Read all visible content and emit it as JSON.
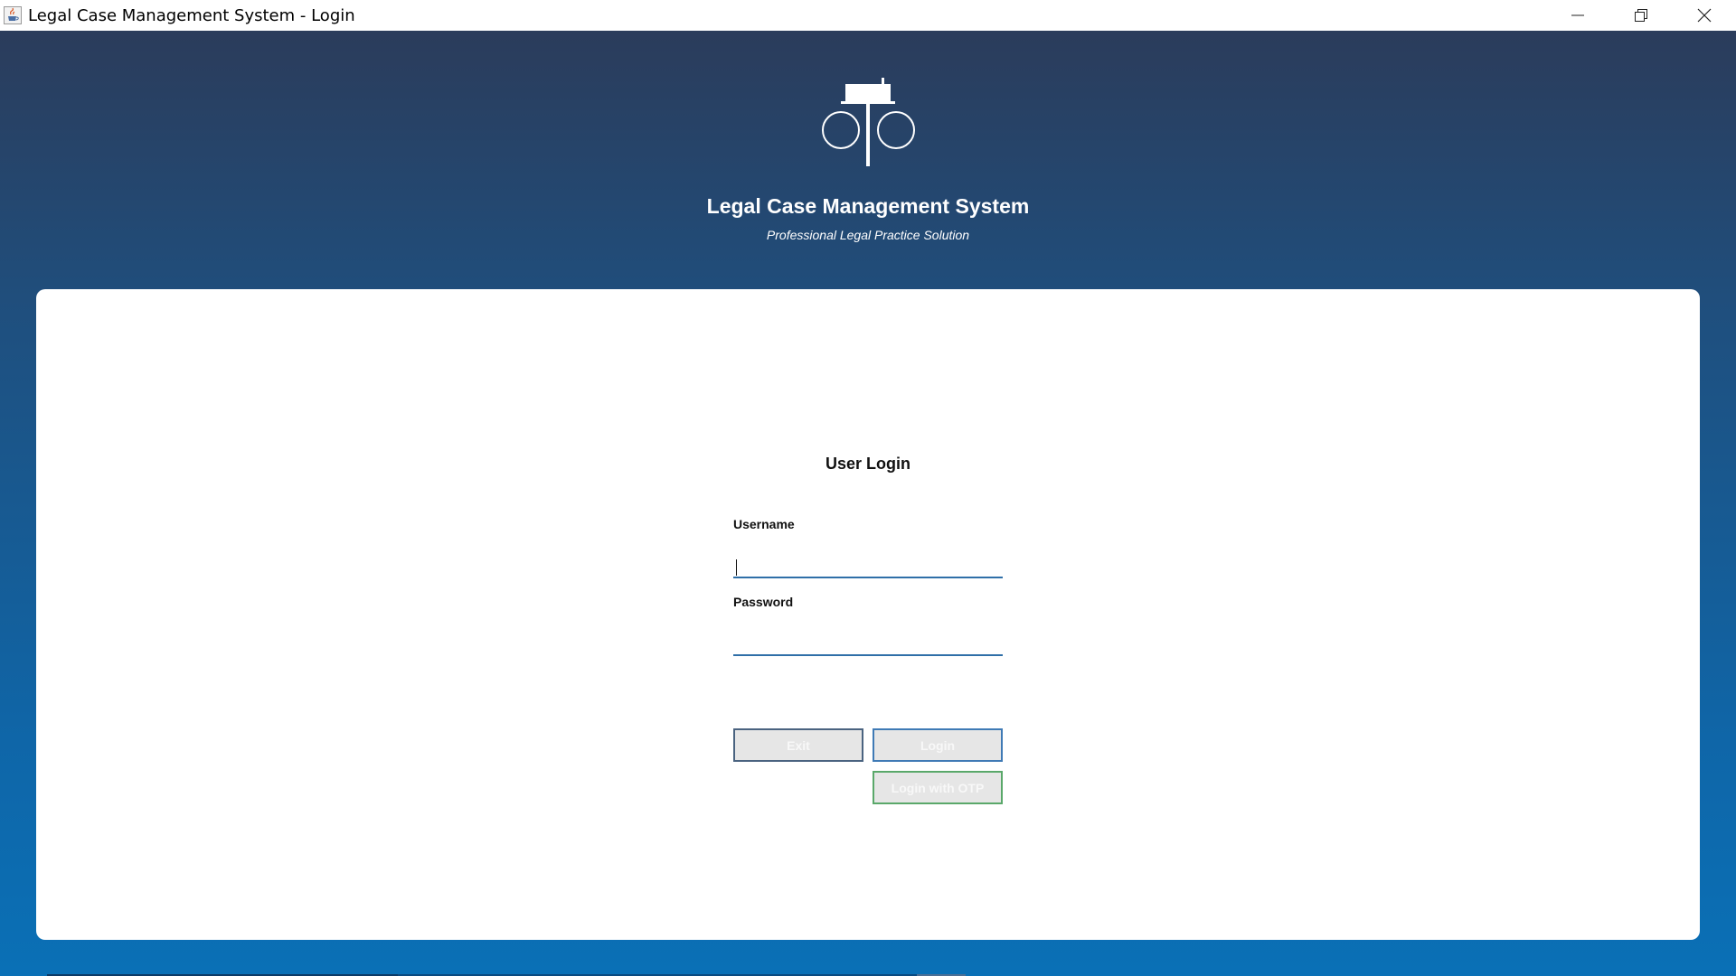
{
  "window": {
    "title": "Legal Case Management System - Login",
    "app_icon": "java-cup-icon",
    "controls": [
      "minimize-icon",
      "restore-icon",
      "close-icon"
    ]
  },
  "header": {
    "logo_icon": "scales-of-justice-icon",
    "title": "Legal Case Management System",
    "subtitle": "Professional Legal Practice Solution"
  },
  "login": {
    "heading": "User Login",
    "username_label": "Username",
    "username_value": "",
    "password_label": "Password",
    "password_value": "",
    "exit_label": "Exit",
    "login_label": "Login",
    "otp_label": "Login with OTP"
  },
  "colors": {
    "gradient_top": "#2b3c5b",
    "gradient_bottom": "#0a70b6",
    "input_underline": "#2f6fa8",
    "exit_border": "#4a6380",
    "login_border": "#3f7ab5",
    "otp_border": "#5aa86a"
  }
}
